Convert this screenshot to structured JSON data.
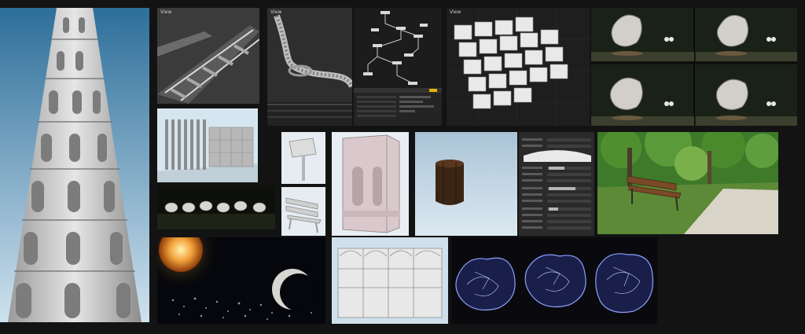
{
  "viewports": {
    "tower_render": {
      "label": ""
    },
    "track_viewport": {
      "label": "View"
    },
    "curve_track_viewport": {
      "label": "View"
    },
    "node_editor": {
      "label": ""
    },
    "crate_viewport": {
      "label": "View"
    },
    "rock_grid": {
      "label": ""
    },
    "fence_viewport": {
      "label": ""
    },
    "rocks_row": {
      "label": ""
    },
    "sign_viewport": {
      "label": ""
    },
    "bench_viewport": {
      "label": ""
    },
    "pillar_viewport": {
      "label": ""
    },
    "barrel_viewport": {
      "label": ""
    },
    "attribute_panel": {
      "label": ""
    },
    "park_photo": {
      "label": ""
    },
    "space_render": {
      "label": ""
    },
    "shelf_viewport": {
      "label": ""
    },
    "asteroid_render": {
      "label": ""
    }
  },
  "colors": {
    "background": "#131313",
    "sky_top": "#2d6f9a",
    "sky_bottom": "#cfe2ef",
    "viewport_gray": "#4a4a4a",
    "node_wire": "#c9c9c9",
    "accent_yellow": "#e6b200",
    "foliage": "#3e7a2a",
    "asteroid_glow": "#8aa0ff"
  },
  "icons": [
    "tower-icon",
    "rail-track-icon",
    "node-graph-icon",
    "crate-icon",
    "rock-icon",
    "fence-icon",
    "sign-icon",
    "bench-icon",
    "pillar-icon",
    "barrel-icon",
    "slider-icon",
    "tree-icon",
    "sun-icon",
    "moon-icon",
    "shelf-icon",
    "asteroid-icon"
  ]
}
